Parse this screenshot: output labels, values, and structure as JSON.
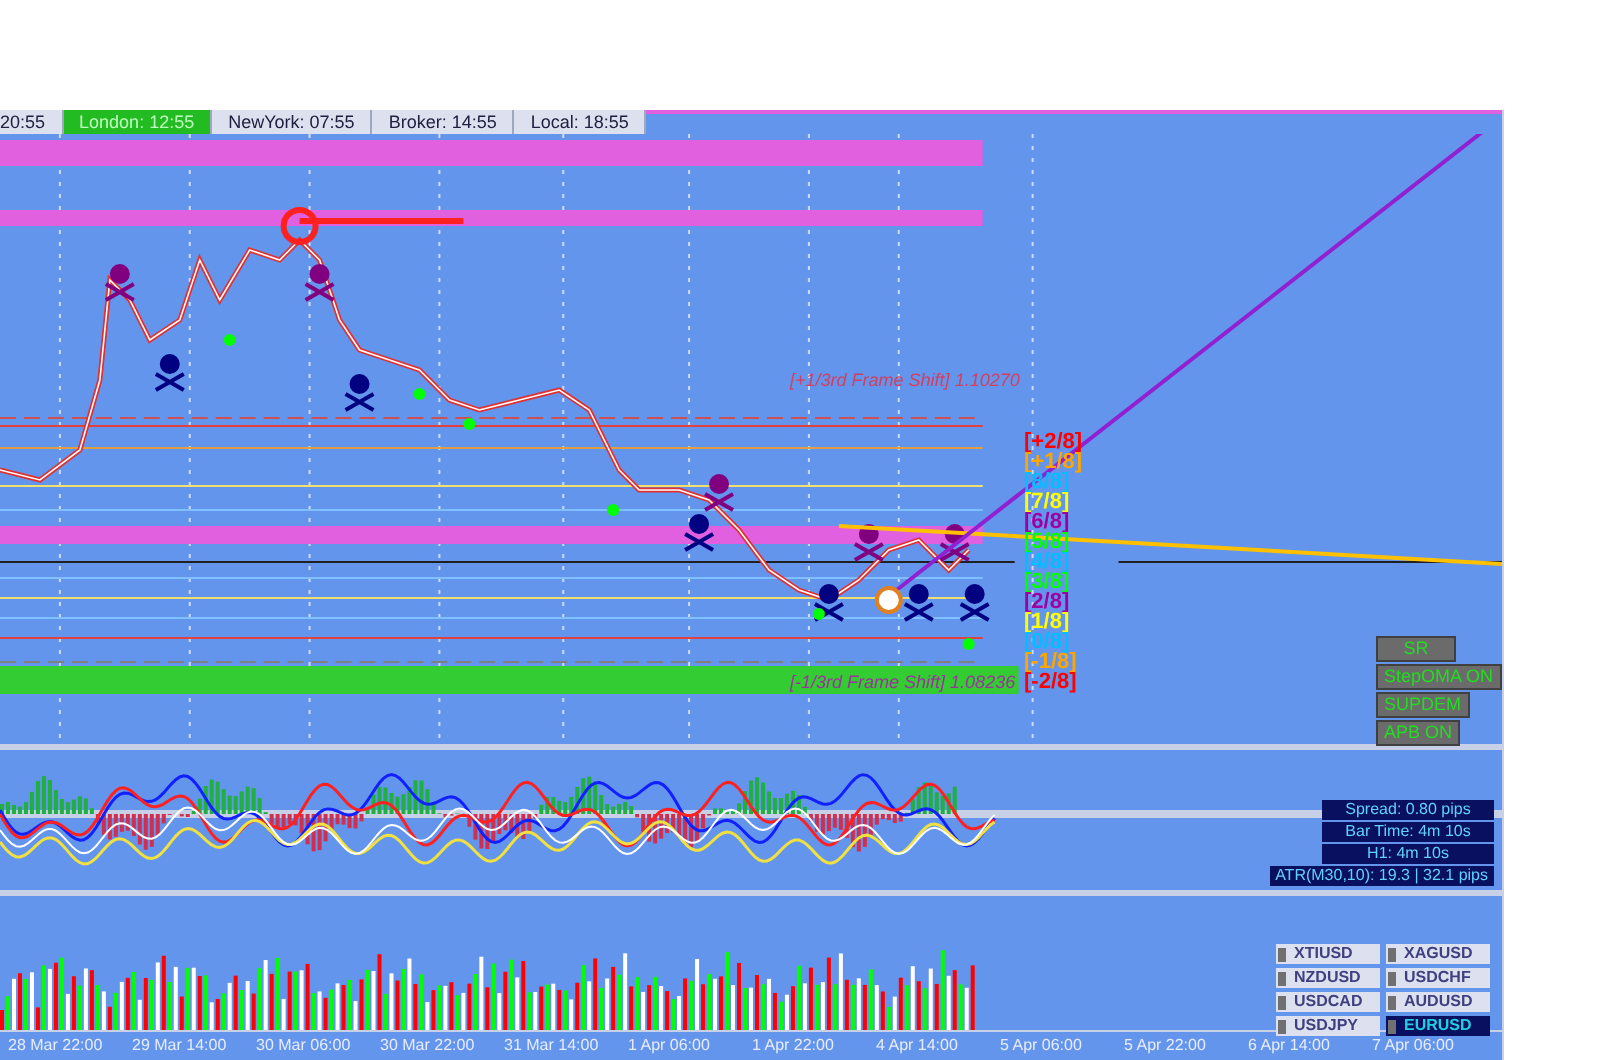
{
  "sessions": [
    {
      "label": "20:55",
      "active": false
    },
    {
      "label": "London: 12:55",
      "active": true
    },
    {
      "label": "NewYork: 07:55",
      "active": false
    },
    {
      "label": "Broker: 14:55",
      "active": false
    },
    {
      "label": "Local: 18:55",
      "active": false
    }
  ],
  "frame_shift": [
    {
      "label": "[+1/3rd Frame Shift]",
      "price": "1.10270"
    },
    {
      "label": "[-1/3rd Frame Shift]",
      "price": "1.08236"
    }
  ],
  "murrey_levels": [
    {
      "label": "[+2/8]",
      "color": "#ff0000"
    },
    {
      "label": "[+1/8]",
      "color": "#ffa500"
    },
    {
      "label": "[8/8]",
      "color": "#00bfff"
    },
    {
      "label": "[7/8]",
      "color": "#ffff00"
    },
    {
      "label": "[6/8]",
      "color": "#a000a0"
    },
    {
      "label": "[5/8]",
      "color": "#00ff00"
    },
    {
      "label": "[4/8]",
      "color": "#00bfff"
    },
    {
      "label": "[3/8]",
      "color": "#00ff00"
    },
    {
      "label": "[2/8]",
      "color": "#a000a0"
    },
    {
      "label": "[1/8]",
      "color": "#ffff00"
    },
    {
      "label": "[0/8]",
      "color": "#00bfff"
    },
    {
      "label": "[-1/8]",
      "color": "#ffa500"
    },
    {
      "label": "[-2/8]",
      "color": "#ff0000"
    }
  ],
  "toggle_buttons": [
    "SR",
    "StepOMA ON",
    "SUPDEM",
    "APB ON"
  ],
  "info_panel": [
    "Spread: 0.80 pips",
    "Bar Time: 4m 10s",
    "H1:  4m 10s",
    "ATR(M30,10): 19.3  |  32.1 pips"
  ],
  "symbols": [
    {
      "label": "XTIUSD",
      "selected": false
    },
    {
      "label": "XAGUSD",
      "selected": false
    },
    {
      "label": "NZDUSD",
      "selected": false
    },
    {
      "label": "USDCHF",
      "selected": false
    },
    {
      "label": "USDCAD",
      "selected": false
    },
    {
      "label": "AUDUSD",
      "selected": false
    },
    {
      "label": "USDJPY",
      "selected": false
    },
    {
      "label": "EURUSD",
      "selected": true
    }
  ],
  "time_axis": [
    "28 Mar 22:00",
    "29 Mar 14:00",
    "30 Mar 06:00",
    "30 Mar 22:00",
    "31 Mar 14:00",
    "1 Apr 06:00",
    "1 Apr 22:00",
    "4 Apr 14:00",
    "5 Apr 06:00",
    "5 Apr 22:00",
    "6 Apr 14:00",
    "7 Apr 06:00"
  ]
}
